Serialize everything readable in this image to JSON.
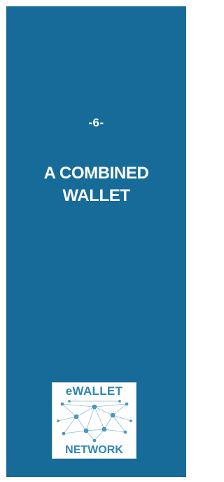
{
  "page": {
    "chapter_number": "-6-",
    "chapter_title_line1": "A COMBINED",
    "chapter_title_line2": "WALLET"
  },
  "logo": {
    "top_text": "eWALLET",
    "bottom_text": "NETWORK",
    "icon": "network-graph-icon"
  },
  "colors": {
    "panel_background": "#176b98",
    "text": "#ffffff",
    "logo_accent": "#2f86b6"
  }
}
